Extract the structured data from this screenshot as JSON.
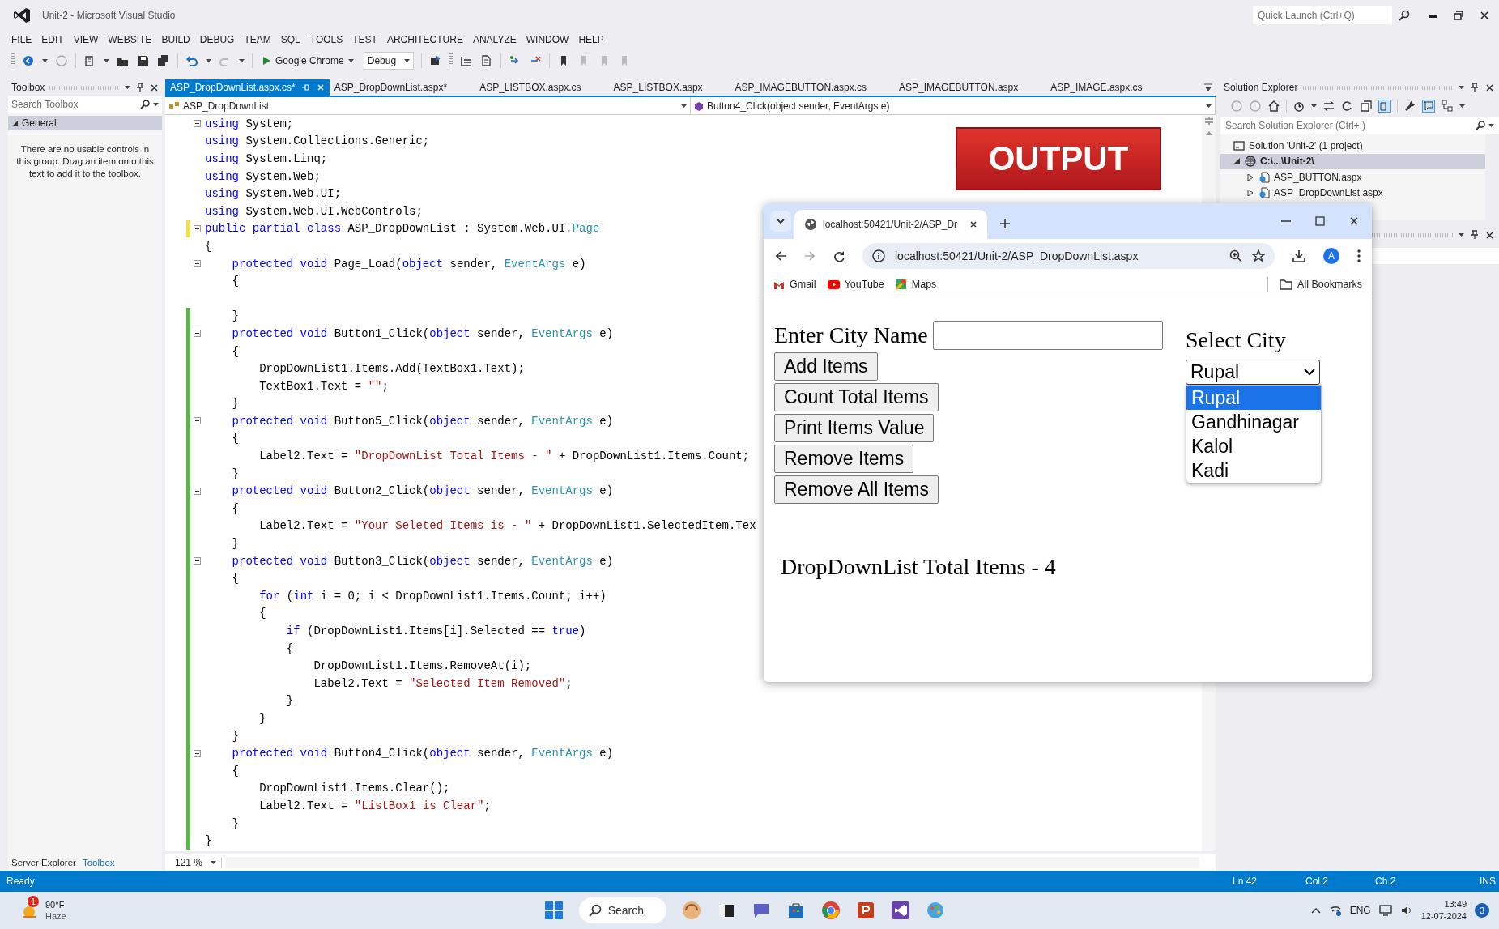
{
  "window": {
    "title": "Unit-2 - Microsoft Visual Studio",
    "quick_launch": {
      "placeholder": "Quick Launch (Ctrl+Q)"
    }
  },
  "menu": [
    "FILE",
    "EDIT",
    "VIEW",
    "WEBSITE",
    "BUILD",
    "DEBUG",
    "TEAM",
    "SQL",
    "TOOLS",
    "TEST",
    "ARCHITECTURE",
    "ANALYZE",
    "WINDOW",
    "HELP"
  ],
  "toolbar": {
    "run_target": "Google Chrome",
    "configuration": "Debug"
  },
  "toolbox": {
    "title": "Toolbox",
    "search": {
      "placeholder": "Search Toolbox"
    },
    "group": {
      "label": "General",
      "expanded": true
    },
    "message": "There are no usable controls in this group. Drag an item onto this text to add it to the toolbox.",
    "bottom_tabs": [
      {
        "label": "Server Explorer",
        "selected": false
      },
      {
        "label": "Toolbox",
        "selected": true
      }
    ]
  },
  "editor": {
    "tabs": [
      {
        "label": "ASP_DropDownList.aspx.cs*",
        "selected": true
      },
      {
        "label": "ASP_DropDownList.aspx*",
        "selected": false
      },
      {
        "label": "ASP_LISTBOX.aspx.cs",
        "selected": false
      },
      {
        "label": "ASP_LISTBOX.aspx",
        "selected": false
      },
      {
        "label": "ASP_IMAGEBUTTON.aspx.cs",
        "selected": false
      },
      {
        "label": "ASP_IMAGEBUTTON.aspx",
        "selected": false
      },
      {
        "label": "ASP_IMAGE.aspx.cs",
        "selected": false
      }
    ],
    "type_dropdown": "ASP_DropDownList",
    "member_dropdown": "Button4_Click(object sender, EventArgs e)",
    "lines": [
      {
        "kind": "code",
        "foldable": true,
        "tokens": [
          {
            "text": "using",
            "kind": "keyword"
          },
          {
            "text": " System;",
            "kind": "plain"
          }
        ]
      },
      {
        "kind": "code",
        "tokens": [
          {
            "text": "using",
            "kind": "keyword"
          },
          {
            "text": " System.Collections.Generic;",
            "kind": "plain"
          }
        ]
      },
      {
        "kind": "code",
        "tokens": [
          {
            "text": "using",
            "kind": "keyword"
          },
          {
            "text": " System.Linq;",
            "kind": "plain"
          }
        ]
      },
      {
        "kind": "code",
        "tokens": [
          {
            "text": "using",
            "kind": "keyword"
          },
          {
            "text": " System.Web;",
            "kind": "plain"
          }
        ]
      },
      {
        "kind": "code",
        "tokens": [
          {
            "text": "using",
            "kind": "keyword"
          },
          {
            "text": " System.Web.UI;",
            "kind": "plain"
          }
        ]
      },
      {
        "kind": "code",
        "tokens": [
          {
            "text": "using",
            "kind": "keyword"
          },
          {
            "text": " System.Web.UI.WebControls;",
            "kind": "plain"
          }
        ]
      },
      {
        "kind": "code",
        "foldable": true,
        "modified": true,
        "saved": false,
        "tokens": [
          {
            "text": "public partial class",
            "kind": "keyword"
          },
          {
            "text": " ASP_DropDownList : System.Web.UI.",
            "kind": "plain"
          },
          {
            "text": "Page",
            "kind": "type"
          }
        ]
      },
      {
        "kind": "code",
        "tokens": [
          {
            "text": "{",
            "kind": "plain"
          }
        ]
      },
      {
        "kind": "code",
        "foldable": true,
        "tokens": [
          {
            "text": "    protected void",
            "kind": "keyword"
          },
          {
            "text": " Page_Load(",
            "kind": "plain"
          },
          {
            "text": "object",
            "kind": "keyword"
          },
          {
            "text": " sender, ",
            "kind": "plain"
          },
          {
            "text": "EventArgs",
            "kind": "type"
          },
          {
            "text": " e)",
            "kind": "plain"
          }
        ]
      },
      {
        "kind": "code",
        "tokens": [
          {
            "text": "    {",
            "kind": "plain"
          }
        ]
      },
      {
        "kind": "blank"
      },
      {
        "kind": "code",
        "modified": true,
        "saved": true,
        "tokens": [
          {
            "text": "    }",
            "kind": "plain"
          }
        ]
      },
      {
        "kind": "code",
        "foldable": true,
        "modified": true,
        "saved": true,
        "tokens": [
          {
            "text": "    protected void",
            "kind": "keyword"
          },
          {
            "text": " Button1_Click(",
            "kind": "plain"
          },
          {
            "text": "object",
            "kind": "keyword"
          },
          {
            "text": " sender, ",
            "kind": "plain"
          },
          {
            "text": "EventArgs",
            "kind": "type"
          },
          {
            "text": " e)",
            "kind": "plain"
          }
        ]
      },
      {
        "kind": "code",
        "modified": true,
        "saved": true,
        "tokens": [
          {
            "text": "    {",
            "kind": "plain"
          }
        ]
      },
      {
        "kind": "code",
        "modified": true,
        "saved": true,
        "tokens": [
          {
            "text": "        DropDownList1.Items.Add(TextBox1.Text);",
            "kind": "plain"
          }
        ]
      },
      {
        "kind": "code",
        "modified": true,
        "saved": true,
        "tokens": [
          {
            "text": "        TextBox1.Text = ",
            "kind": "plain"
          },
          {
            "text": "\"\"",
            "kind": "string"
          },
          {
            "text": ";",
            "kind": "plain"
          }
        ]
      },
      {
        "kind": "code",
        "modified": true,
        "saved": true,
        "tokens": [
          {
            "text": "    }",
            "kind": "plain"
          }
        ]
      },
      {
        "kind": "code",
        "foldable": true,
        "modified": true,
        "saved": true,
        "tokens": [
          {
            "text": "    protected void",
            "kind": "keyword"
          },
          {
            "text": " Button5_Click(",
            "kind": "plain"
          },
          {
            "text": "object",
            "kind": "keyword"
          },
          {
            "text": " sender, ",
            "kind": "plain"
          },
          {
            "text": "EventArgs",
            "kind": "type"
          },
          {
            "text": " e)",
            "kind": "plain"
          }
        ]
      },
      {
        "kind": "code",
        "modified": true,
        "saved": true,
        "tokens": [
          {
            "text": "    {",
            "kind": "plain"
          }
        ]
      },
      {
        "kind": "code",
        "modified": true,
        "saved": true,
        "tokens": [
          {
            "text": "        Label2.Text = ",
            "kind": "plain"
          },
          {
            "text": "\"DropDownList Total Items - \"",
            "kind": "string"
          },
          {
            "text": " + DropDownList1.Items.Count;",
            "kind": "plain"
          }
        ]
      },
      {
        "kind": "code",
        "modified": true,
        "saved": true,
        "tokens": [
          {
            "text": "    }",
            "kind": "plain"
          }
        ]
      },
      {
        "kind": "code",
        "foldable": true,
        "modified": true,
        "saved": true,
        "tokens": [
          {
            "text": "    protected void",
            "kind": "keyword"
          },
          {
            "text": " Button2_Click(",
            "kind": "plain"
          },
          {
            "text": "object",
            "kind": "keyword"
          },
          {
            "text": " sender, ",
            "kind": "plain"
          },
          {
            "text": "EventArgs",
            "kind": "type"
          },
          {
            "text": " e)",
            "kind": "plain"
          }
        ]
      },
      {
        "kind": "code",
        "modified": true,
        "saved": true,
        "tokens": [
          {
            "text": "    {",
            "kind": "plain"
          }
        ]
      },
      {
        "kind": "code",
        "modified": true,
        "saved": true,
        "tokens": [
          {
            "text": "        Label2.Text = ",
            "kind": "plain"
          },
          {
            "text": "\"Your Seleted Items is - \"",
            "kind": "string"
          },
          {
            "text": " + DropDownList1.SelectedItem.Tex",
            "kind": "plain"
          }
        ]
      },
      {
        "kind": "code",
        "modified": true,
        "saved": true,
        "tokens": [
          {
            "text": "    }",
            "kind": "plain"
          }
        ]
      },
      {
        "kind": "code",
        "foldable": true,
        "modified": true,
        "saved": true,
        "tokens": [
          {
            "text": "    protected void",
            "kind": "keyword"
          },
          {
            "text": " Button3_Click(",
            "kind": "plain"
          },
          {
            "text": "object",
            "kind": "keyword"
          },
          {
            "text": " sender, ",
            "kind": "plain"
          },
          {
            "text": "EventArgs",
            "kind": "type"
          },
          {
            "text": " e)",
            "kind": "plain"
          }
        ]
      },
      {
        "kind": "code",
        "modified": true,
        "saved": true,
        "tokens": [
          {
            "text": "    {",
            "kind": "plain"
          }
        ]
      },
      {
        "kind": "code",
        "modified": true,
        "saved": true,
        "tokens": [
          {
            "text": "        for",
            "kind": "keyword"
          },
          {
            "text": " (",
            "kind": "plain"
          },
          {
            "text": "int",
            "kind": "keyword"
          },
          {
            "text": " i = 0; i < DropDownList1.Items.Count; i++)",
            "kind": "plain"
          }
        ]
      },
      {
        "kind": "code",
        "modified": true,
        "saved": true,
        "tokens": [
          {
            "text": "        {",
            "kind": "plain"
          }
        ]
      },
      {
        "kind": "code",
        "modified": true,
        "saved": true,
        "tokens": [
          {
            "text": "            if",
            "kind": "keyword"
          },
          {
            "text": " (DropDownList1.Items[i].Selected == ",
            "kind": "plain"
          },
          {
            "text": "true",
            "kind": "keyword"
          },
          {
            "text": ")",
            "kind": "plain"
          }
        ]
      },
      {
        "kind": "code",
        "modified": true,
        "saved": true,
        "tokens": [
          {
            "text": "            {",
            "kind": "plain"
          }
        ]
      },
      {
        "kind": "code",
        "modified": true,
        "saved": true,
        "tokens": [
          {
            "text": "                DropDownList1.Items.RemoveAt(i);",
            "kind": "plain"
          }
        ]
      },
      {
        "kind": "code",
        "modified": true,
        "saved": true,
        "tokens": [
          {
            "text": "                Label2.Text = ",
            "kind": "plain"
          },
          {
            "text": "\"Selected Item Removed\"",
            "kind": "string"
          },
          {
            "text": ";",
            "kind": "plain"
          }
        ]
      },
      {
        "kind": "code",
        "modified": true,
        "saved": true,
        "tokens": [
          {
            "text": "            }",
            "kind": "plain"
          }
        ]
      },
      {
        "kind": "code",
        "modified": true,
        "saved": true,
        "tokens": [
          {
            "text": "        }",
            "kind": "plain"
          }
        ]
      },
      {
        "kind": "code",
        "modified": true,
        "saved": true,
        "tokens": [
          {
            "text": "    }",
            "kind": "plain"
          }
        ]
      },
      {
        "kind": "code",
        "foldable": true,
        "modified": true,
        "saved": true,
        "tokens": [
          {
            "text": "    protected void",
            "kind": "keyword"
          },
          {
            "text": " Button4_Click(",
            "kind": "plain"
          },
          {
            "text": "object",
            "kind": "keyword"
          },
          {
            "text": " sender, ",
            "kind": "plain"
          },
          {
            "text": "EventArgs",
            "kind": "type"
          },
          {
            "text": " e)",
            "kind": "plain"
          }
        ]
      },
      {
        "kind": "code",
        "modified": true,
        "saved": true,
        "tokens": [
          {
            "text": "    {",
            "kind": "plain"
          }
        ]
      },
      {
        "kind": "code",
        "modified": true,
        "saved": true,
        "tokens": [
          {
            "text": "        DropDownList1.Items.Clear();",
            "kind": "plain"
          }
        ]
      },
      {
        "kind": "code",
        "modified": true,
        "saved": true,
        "tokens": [
          {
            "text": "        Label2.Text = ",
            "kind": "plain"
          },
          {
            "text": "\"ListBox1 is Clear\"",
            "kind": "string"
          },
          {
            "text": ";",
            "kind": "plain"
          }
        ]
      },
      {
        "kind": "code",
        "modified": true,
        "saved": true,
        "tokens": [
          {
            "text": "    }",
            "kind": "plain"
          }
        ]
      },
      {
        "kind": "code",
        "modified": true,
        "saved": true,
        "tokens": [
          {
            "text": "}",
            "kind": "plain"
          }
        ]
      }
    ],
    "zoom": "121 %"
  },
  "overlay_banner": "OUTPUT",
  "solution_explorer": {
    "title": "Solution Explorer",
    "search": {
      "placeholder": "Search Solution Explorer (Ctrl+;)"
    },
    "tree": [
      {
        "label": "Solution 'Unit-2' (1 project)",
        "kind": "solution",
        "selected": false,
        "children": [
          {
            "label": "C:\\...\\Unit-2\\",
            "kind": "website",
            "expanded": true,
            "selected": true,
            "children": [
              {
                "label": "ASP_BUTTON.aspx",
                "kind": "page",
                "expanded": false,
                "selected": false
              },
              {
                "label": "ASP_DropDownList.aspx",
                "kind": "page",
                "expanded": false,
                "selected": false
              }
            ]
          }
        ]
      }
    ]
  },
  "status_bar": {
    "message": "Ready",
    "line": "Ln 42",
    "column": "Col 2",
    "character": "Ch 2",
    "mode": "INS"
  },
  "browser": {
    "tab_title": "localhost:50421/Unit-2/ASP_Dr",
    "address": "localhost:50421/Unit-2/ASP_DropDownList.aspx",
    "profile_initial": "A",
    "bookmarks": [
      {
        "label": "Gmail",
        "kind": "gmail"
      },
      {
        "label": "YouTube",
        "kind": "youtube"
      },
      {
        "label": "Maps",
        "kind": "maps"
      }
    ],
    "all_bookmarks": "All Bookmarks",
    "page": {
      "city_label": "Enter City Name",
      "buttons": [
        "Add Items",
        "Count Total Items",
        "Print Items Value",
        "Remove Items",
        "Remove All Items"
      ],
      "select_label": "Select City",
      "select": {
        "value": "Rupal",
        "expanded": true,
        "options": [
          {
            "label": "Rupal",
            "selected": true
          },
          {
            "label": "Gandhinagar",
            "selected": false
          },
          {
            "label": "Kalol",
            "selected": false
          },
          {
            "label": "Kadi",
            "selected": false
          }
        ]
      },
      "result": "DropDownList Total Items - 4"
    }
  },
  "taskbar": {
    "weather": {
      "temperature": "90°F",
      "condition": "Haze",
      "badge": "1"
    },
    "search": "Search",
    "language": "ENG",
    "time": "13:49",
    "date": "12-07-2024",
    "notifications": "3"
  }
}
